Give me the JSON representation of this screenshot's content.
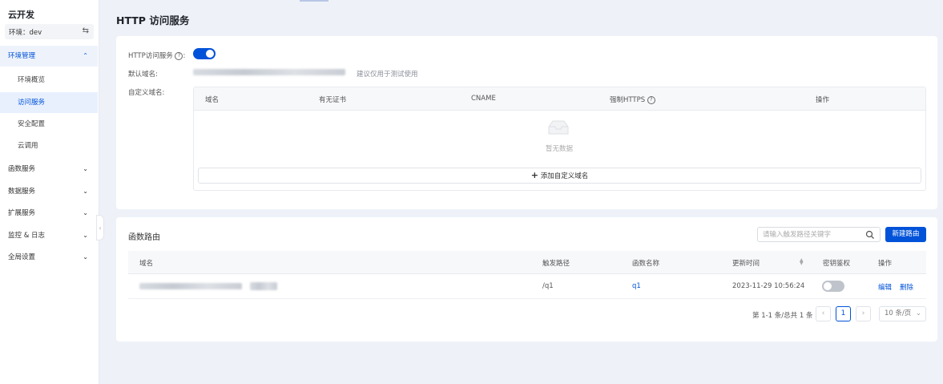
{
  "sidebar": {
    "app_title": "云开发",
    "env_label": "环境：dev",
    "env_switch_icon": "swap-icon",
    "menu": [
      {
        "label": "环境管理",
        "expanded": true
      },
      {
        "label": "环境概览"
      },
      {
        "label": "访问服务",
        "active": true
      },
      {
        "label": "安全配置"
      },
      {
        "label": "云调用"
      },
      {
        "label": "函数服务"
      },
      {
        "label": "数据服务"
      },
      {
        "label": "扩展服务"
      },
      {
        "label": "监控 & 日志"
      },
      {
        "label": "全局设置"
      }
    ]
  },
  "page": {
    "title": "HTTP 访问服务"
  },
  "http_card": {
    "service_label": "HTTP访问服务",
    "service_enabled": true,
    "default_domain_label": "默认域名:",
    "default_domain_hint": "建议仅用于测试使用",
    "custom_domain_label": "自定义域名:",
    "custom_table": {
      "columns": [
        "域名",
        "有无证书",
        "CNAME",
        "强制HTTPS",
        "操作"
      ],
      "empty_text": "暂无数据",
      "add_button": "添加自定义域名"
    }
  },
  "routes_card": {
    "title": "函数路由",
    "search_placeholder": "请输入触发路径关键字",
    "new_button": "新建路由",
    "columns": [
      "域名",
      "触发路径",
      "函数名称",
      "更新时间",
      "密钥鉴权",
      "操作"
    ],
    "rows": [
      {
        "path": "/q1",
        "function": "q1",
        "updated": "2023-11-29 10:56:24",
        "auth_enabled": false,
        "action_edit": "编辑",
        "action_delete": "删除"
      }
    ],
    "pagination": {
      "summary": "第 1-1 条/总共 1 条",
      "current_page": "1",
      "page_size": "10 条/页"
    }
  },
  "colors": {
    "primary": "#0052d9",
    "bg": "#eef2f8"
  }
}
